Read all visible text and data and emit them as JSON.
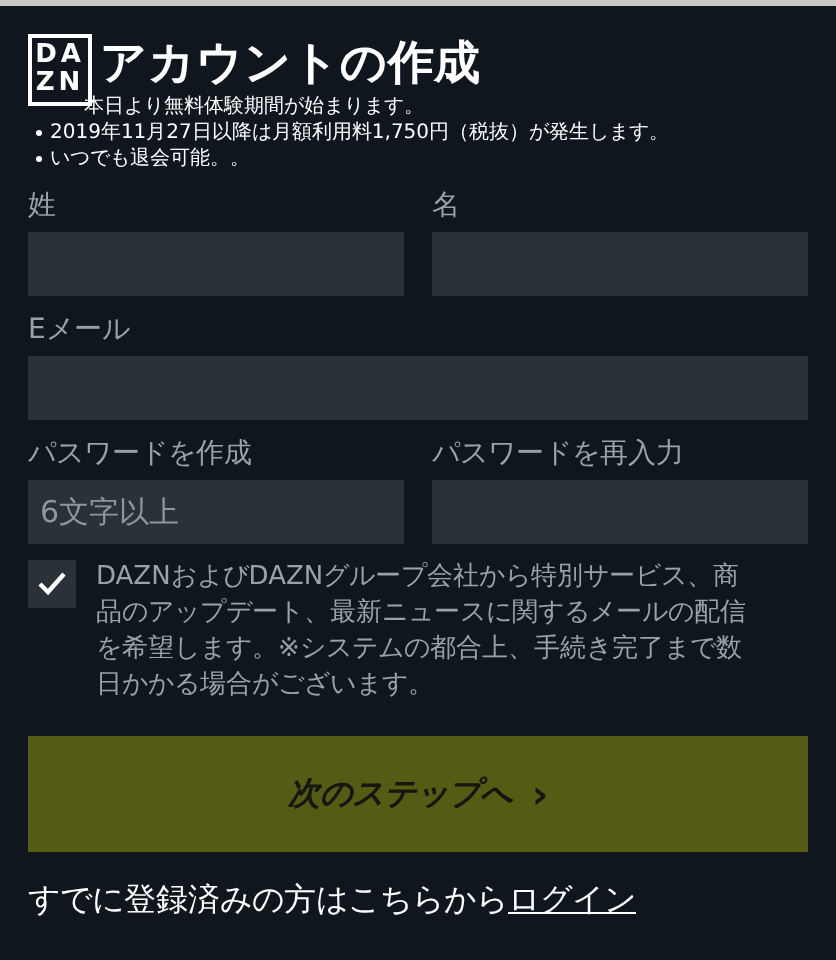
{
  "logo": {
    "top": "DA",
    "bottom": "ZN"
  },
  "title": "アカウントの作成",
  "notes": [
    "本日より無料体験期間が始まります。",
    "2019年11月27日以降は月額利用料1,750円（税抜）が発生します。",
    "いつでも退会可能。。"
  ],
  "fields": [
    {
      "label": "姓"
    },
    {
      "label": "名"
    },
    {
      "label": "Eメール"
    },
    {
      "label": "パスワードを作成",
      "placeholder": "6文字以上"
    },
    {
      "label": "パスワードを再入力"
    }
  ],
  "consent": {
    "checked": true,
    "text": "DAZNおよびDAZNグループ会社から特別サービス、商品のアップデート、最新ニュースに関するメールの配信を希望します。※システムの都合上、手続き完了まで数日かかる場合がございます。"
  },
  "next_button": {
    "label": "次のステップへ",
    "arrow": "›"
  },
  "login": {
    "text": "すでに登録済みの方はこちらから",
    "link": "ログイン"
  }
}
